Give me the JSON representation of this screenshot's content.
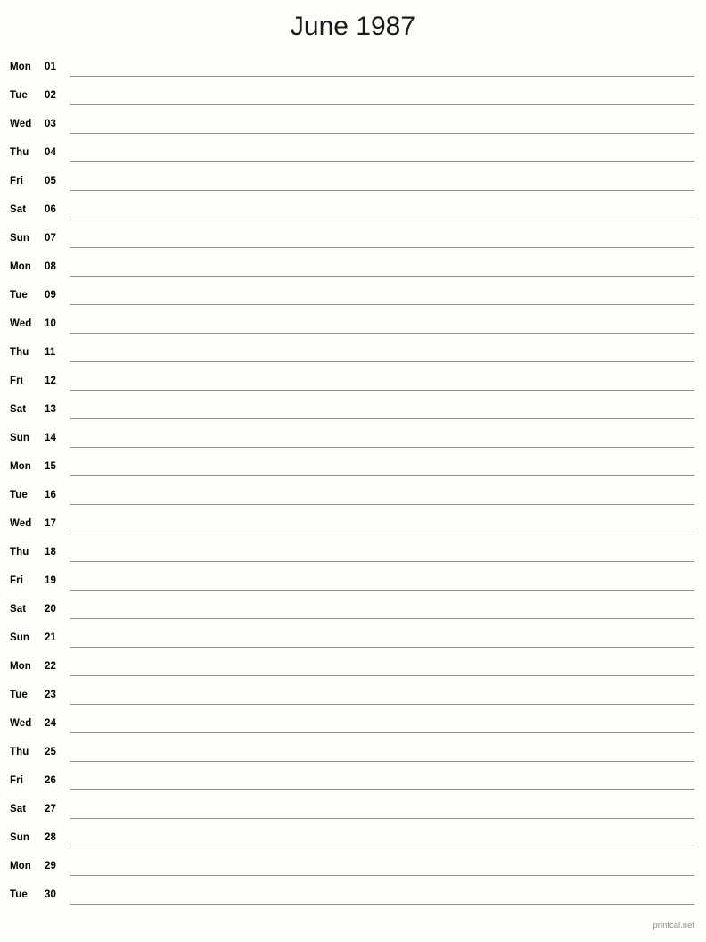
{
  "document": {
    "title": "June 1987",
    "month_name": "June",
    "year": "1987"
  },
  "footer": {
    "credit": "printcal.net"
  },
  "colors": {
    "page_background": "#fdfdfa",
    "text": "#000000",
    "title_text": "#1a1a1a",
    "rule_line": "#9a9a95",
    "footer_text": "#8d8d8d"
  },
  "calendar": {
    "type": "notepad-day-list",
    "days_in_month": 30,
    "first_weekday": "Mon",
    "last_weekday": "Tue",
    "rows": [
      {
        "weekday": "Mon",
        "day": "01"
      },
      {
        "weekday": "Tue",
        "day": "02"
      },
      {
        "weekday": "Wed",
        "day": "03"
      },
      {
        "weekday": "Thu",
        "day": "04"
      },
      {
        "weekday": "Fri",
        "day": "05"
      },
      {
        "weekday": "Sat",
        "day": "06"
      },
      {
        "weekday": "Sun",
        "day": "07"
      },
      {
        "weekday": "Mon",
        "day": "08"
      },
      {
        "weekday": "Tue",
        "day": "09"
      },
      {
        "weekday": "Wed",
        "day": "10"
      },
      {
        "weekday": "Thu",
        "day": "11"
      },
      {
        "weekday": "Fri",
        "day": "12"
      },
      {
        "weekday": "Sat",
        "day": "13"
      },
      {
        "weekday": "Sun",
        "day": "14"
      },
      {
        "weekday": "Mon",
        "day": "15"
      },
      {
        "weekday": "Tue",
        "day": "16"
      },
      {
        "weekday": "Wed",
        "day": "17"
      },
      {
        "weekday": "Thu",
        "day": "18"
      },
      {
        "weekday": "Fri",
        "day": "19"
      },
      {
        "weekday": "Sat",
        "day": "20"
      },
      {
        "weekday": "Sun",
        "day": "21"
      },
      {
        "weekday": "Mon",
        "day": "22"
      },
      {
        "weekday": "Tue",
        "day": "23"
      },
      {
        "weekday": "Wed",
        "day": "24"
      },
      {
        "weekday": "Thu",
        "day": "25"
      },
      {
        "weekday": "Fri",
        "day": "26"
      },
      {
        "weekday": "Sat",
        "day": "27"
      },
      {
        "weekday": "Sun",
        "day": "28"
      },
      {
        "weekday": "Mon",
        "day": "29"
      },
      {
        "weekday": "Tue",
        "day": "30"
      }
    ]
  }
}
